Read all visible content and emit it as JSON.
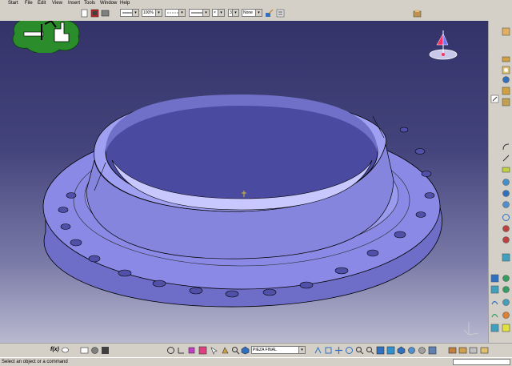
{
  "menu": {
    "items": [
      "Start",
      "File",
      "Edit",
      "View",
      "Insert",
      "Tools",
      "Window",
      "Help"
    ]
  },
  "toolbar": {
    "line_style_value": "",
    "zoom_value": "100%",
    "line_type_value": "",
    "line_weight_value": "",
    "x_value": "×",
    "layer_number_value": "3",
    "layer_value": "None"
  },
  "bottom_toolbar": {
    "fx_label": "f(x)",
    "part_name": "PIEZA FINAL"
  },
  "status": {
    "message": "Select an object or a command"
  },
  "colors": {
    "viewport_top": "#33336a",
    "viewport_bottom": "#b9b9d0",
    "part_fill": "#8a8ae6",
    "logo_green": "#2a8c2a"
  }
}
